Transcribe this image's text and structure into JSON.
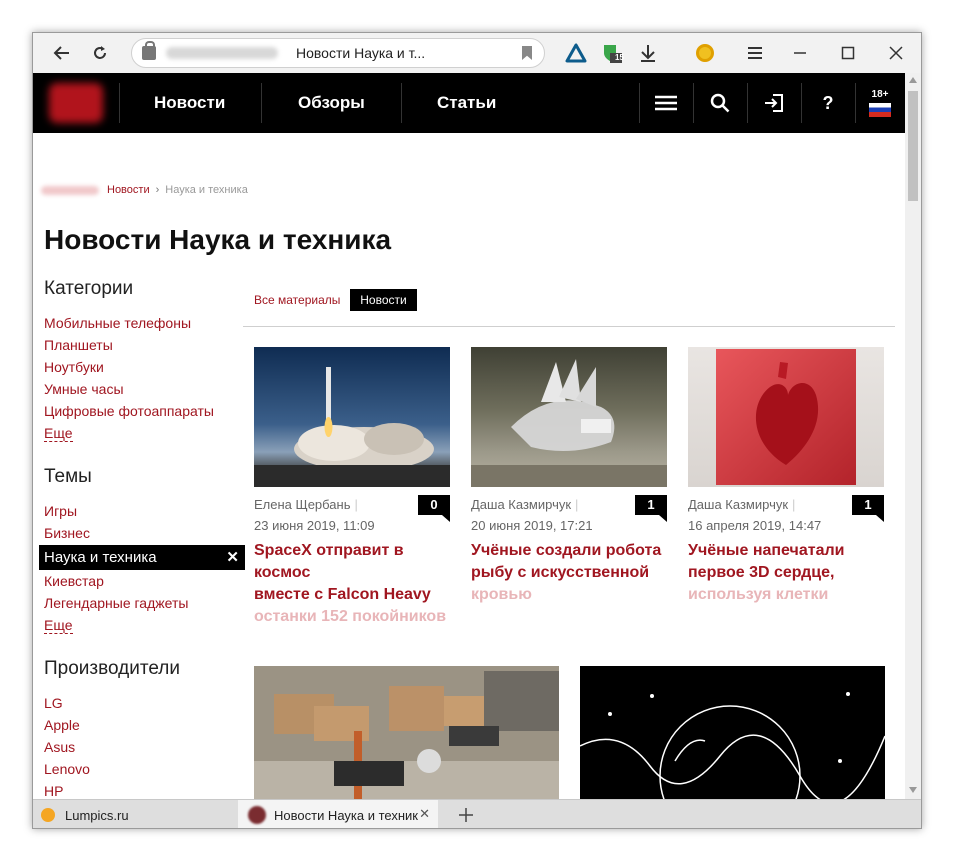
{
  "browser": {
    "url_title": "Новости Наука и т...",
    "ext_badge": "15"
  },
  "site": {
    "nav": [
      "Новости",
      "Обзоры",
      "Статьи"
    ],
    "age_badge": "18+",
    "help_label": "?"
  },
  "breadcrumb": {
    "link": "Новости",
    "current": "Наука и техника"
  },
  "page_title": "Новости Наука и техника",
  "sidebar": {
    "categories_heading": "Категории",
    "categories": [
      "Мобильные телефоны",
      "Планшеты",
      "Ноутбуки",
      "Умные часы",
      "Цифровые фотоаппараты",
      "Еще"
    ],
    "themes_heading": "Темы",
    "themes_before": [
      "Игры",
      "Бизнес"
    ],
    "themes_active": "Наука и техника",
    "themes_after": [
      "Киевстар",
      "Легендарные гаджеты",
      "Еще"
    ],
    "makers_heading": "Производители",
    "makers": [
      "LG",
      "Apple",
      "Asus",
      "Lenovo",
      "HP"
    ]
  },
  "filters": {
    "all": "Все материалы",
    "news": "Новости"
  },
  "cards": [
    {
      "author": "Елена Щербань",
      "date": "23 июня 2019, 11:09",
      "count": "0",
      "title1": "SpaceX отправит в космос",
      "title2": "вместе с Falcon Heavy",
      "title3": "останки 152 покойников"
    },
    {
      "author": "Даша Казмирчук",
      "date": "20 июня 2019, 17:21",
      "count": "1",
      "title1": "Учёные создали робота",
      "title2": "рыбу с искусственной",
      "title3": "кровью"
    },
    {
      "author": "Даша Казмирчук",
      "date": "16 апреля 2019, 14:47",
      "count": "1",
      "title1": "Учёные напечатали",
      "title2": "первое 3D сердце,",
      "title3": "используя клетки"
    }
  ],
  "tabs": [
    {
      "label": "Lumpics.ru"
    },
    {
      "label": "Новости Наука и техник"
    }
  ],
  "colors": {
    "brand": "#a01620",
    "header_bg": "#000000"
  }
}
